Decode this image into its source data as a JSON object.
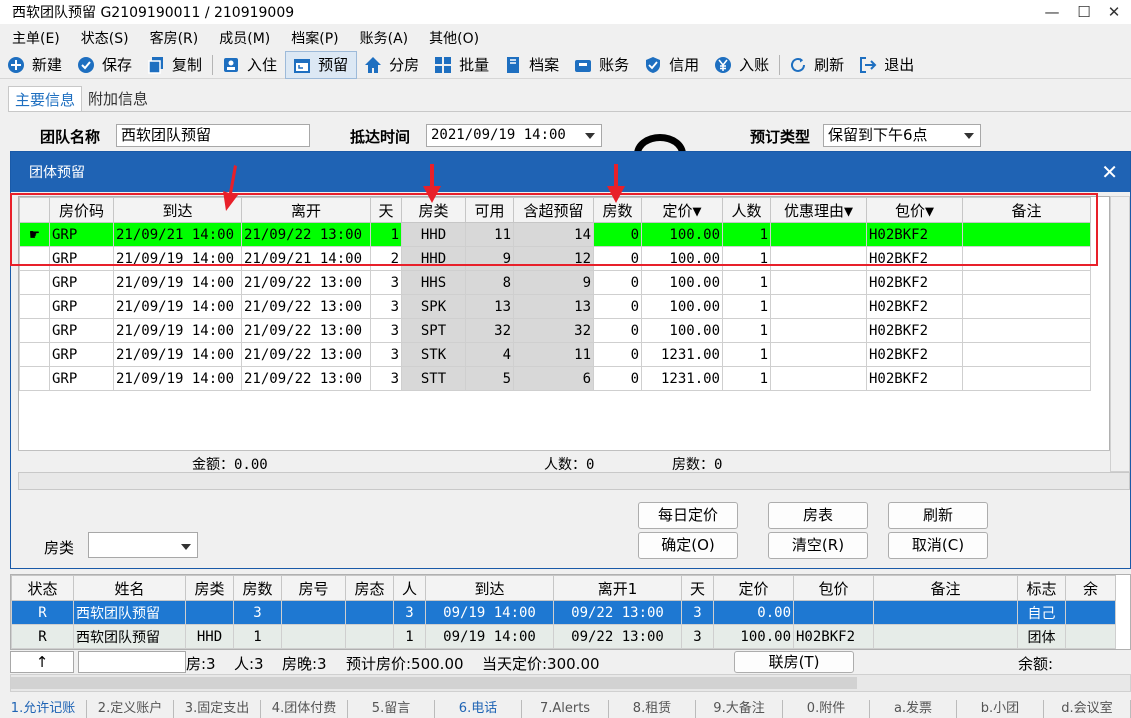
{
  "window": {
    "title": "西软团队预留  G2109190011 / 210919009",
    "min_glyph": "—",
    "max_glyph": "☐",
    "close_glyph": "✕"
  },
  "menu": [
    "主单(E)",
    "状态(S)",
    "客房(R)",
    "成员(M)",
    "档案(P)",
    "账务(A)",
    "其他(O)"
  ],
  "toolbar": [
    {
      "label": "新建",
      "icon": "plus-circle-icon"
    },
    {
      "label": "保存",
      "icon": "check-circle-icon"
    },
    {
      "label": "复制",
      "icon": "copy-icon"
    },
    {
      "label": "入住",
      "icon": "checkin-icon"
    },
    {
      "label": "预留",
      "icon": "calendar-icon",
      "active": true
    },
    {
      "label": "分房",
      "icon": "home-icon"
    },
    {
      "label": "批量",
      "icon": "grid-icon"
    },
    {
      "label": "档案",
      "icon": "book-icon"
    },
    {
      "label": "账务",
      "icon": "wallet-icon"
    },
    {
      "label": "信用",
      "icon": "shield-icon"
    },
    {
      "label": "入账",
      "icon": "yen-icon"
    },
    {
      "label": "刷新",
      "icon": "refresh-icon"
    },
    {
      "label": "退出",
      "icon": "exit-icon"
    }
  ],
  "tabs": {
    "main": "主要信息",
    "extra": "附加信息"
  },
  "form": {
    "team_name_label": "团队名称",
    "team_name_value": "西软团队预留",
    "arrival_label": "抵达时间",
    "arrival_value": "2021/09/19 14:00",
    "booking_type_label": "预订类型",
    "booking_type_value": "保留到下午6点"
  },
  "dialog": {
    "title": "团体预留",
    "close": "✕",
    "columns": [
      "",
      "房价码",
      "到达",
      "离开",
      "天",
      "房类",
      "可用",
      "含超预留",
      "房数",
      "定价▼",
      "人数",
      "优惠理由▼",
      "包价▼",
      "备注"
    ],
    "rows": [
      {
        "code": "GRP",
        "arrive": "21/09/21 14:00",
        "leave": "21/09/22 13:00",
        "days": "1",
        "type": "HHD",
        "avail": "11",
        "over": "14",
        "rooms": "0",
        "price": "100.00",
        "people": "1",
        "reason": "",
        "pkg": "H02BKF2",
        "note": ""
      },
      {
        "code": "GRP",
        "arrive": "21/09/19 14:00",
        "leave": "21/09/21 14:00",
        "days": "2",
        "type": "HHD",
        "avail": "9",
        "over": "12",
        "rooms": "0",
        "price": "100.00",
        "people": "1",
        "reason": "",
        "pkg": "H02BKF2",
        "note": ""
      },
      {
        "code": "GRP",
        "arrive": "21/09/19 14:00",
        "leave": "21/09/22 13:00",
        "days": "3",
        "type": "HHS",
        "avail": "8",
        "over": "9",
        "rooms": "0",
        "price": "100.00",
        "people": "1",
        "reason": "",
        "pkg": "H02BKF2",
        "note": ""
      },
      {
        "code": "GRP",
        "arrive": "21/09/19 14:00",
        "leave": "21/09/22 13:00",
        "days": "3",
        "type": "SPK",
        "avail": "13",
        "over": "13",
        "rooms": "0",
        "price": "100.00",
        "people": "1",
        "reason": "",
        "pkg": "H02BKF2",
        "note": ""
      },
      {
        "code": "GRP",
        "arrive": "21/09/19 14:00",
        "leave": "21/09/22 13:00",
        "days": "3",
        "type": "SPT",
        "avail": "32",
        "over": "32",
        "rooms": "0",
        "price": "100.00",
        "people": "1",
        "reason": "",
        "pkg": "H02BKF2",
        "note": ""
      },
      {
        "code": "GRP",
        "arrive": "21/09/19 14:00",
        "leave": "21/09/22 13:00",
        "days": "3",
        "type": "STK",
        "avail": "4",
        "over": "11",
        "rooms": "0",
        "price": "1231.00",
        "people": "1",
        "reason": "",
        "pkg": "H02BKF2",
        "note": ""
      },
      {
        "code": "GRP",
        "arrive": "21/09/19 14:00",
        "leave": "21/09/22 13:00",
        "days": "3",
        "type": "STT",
        "avail": "5",
        "over": "6",
        "rooms": "0",
        "price": "1231.00",
        "people": "1",
        "reason": "",
        "pkg": "H02BKF2",
        "note": ""
      }
    ],
    "summary": {
      "amount": "金额：0.00",
      "people": "人数：0",
      "rooms": "房数：0"
    },
    "buttons": {
      "daily_price": "每日定价",
      "room_table": "房表",
      "refresh": "刷新",
      "confirm": "确定(O)",
      "clear": "清空(R)",
      "cancel": "取消(C)"
    },
    "room_type_label": "房类",
    "room_type_value": ""
  },
  "bottom_grid": {
    "columns": [
      "状态",
      "姓名",
      "房类",
      "房数",
      "房号",
      "房态",
      "人",
      "到达",
      "离开1",
      "天",
      "定价",
      "包价",
      "备注",
      "标志",
      "余"
    ],
    "rows": [
      {
        "status": "R",
        "name": "西软团队预留",
        "type": "",
        "rooms": "3",
        "roomno": "",
        "rstate": "",
        "people": "3",
        "arrive": "09/19 14:00",
        "leave": "09/22 13:00",
        "days": "3",
        "price": "0.00",
        "pkg": "",
        "note": "",
        "flag": "自己"
      },
      {
        "status": "R",
        "name": "西软团队预留",
        "type": "HHD",
        "rooms": "1",
        "roomno": "",
        "rstate": "",
        "people": "1",
        "arrive": "09/19 14:00",
        "leave": "09/22 13:00",
        "days": "3",
        "price": "100.00",
        "pkg": "H02BKF2",
        "note": "",
        "flag": "团体"
      }
    ]
  },
  "status_bar": {
    "up_arrow": "↑",
    "rooms": "房:3",
    "people": "人:3",
    "nights": "房晚:3",
    "est_price": "预计房价:500.00",
    "day_price": "当天定价:300.00",
    "link_room": "联房(T)",
    "balance": "余额:"
  },
  "fkeys": [
    "1.允许记账",
    "2.定义账户",
    "3.固定支出",
    "4.团体付费",
    "5.留言",
    "6.电话",
    "7.Alerts",
    "8.租赁",
    "9.大备注",
    "0.附件",
    "a.发票",
    "b.小团",
    "d.会议室"
  ],
  "colors": {
    "accent": "#1e63b4",
    "selected_row": "#00ff00",
    "annotation": "#e8202a"
  }
}
